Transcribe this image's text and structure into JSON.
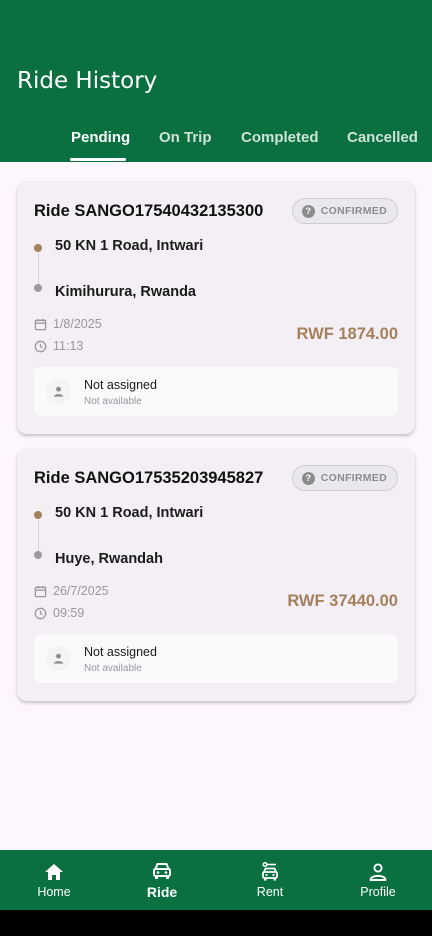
{
  "header": {
    "title": "Ride History",
    "tabs": [
      {
        "label": "Pending",
        "active": true
      },
      {
        "label": "On Trip",
        "active": false
      },
      {
        "label": "Completed",
        "active": false
      },
      {
        "label": "Cancelled",
        "active": false
      }
    ]
  },
  "rides": [
    {
      "title": "Ride SANGO17540432135300",
      "status": "CONFIRMED",
      "pickup": "50 KN 1 Road, Intwari",
      "dropoff": "Kimihurura, Rwanda",
      "date": "1/8/2025",
      "time": "11:13",
      "price": "RWF 1874.00",
      "driver_name": "Not assigned",
      "driver_info": "Not available"
    },
    {
      "title": "Ride SANGO17535203945827",
      "status": "CONFIRMED",
      "pickup": "50 KN 1 Road, Intwari",
      "dropoff": "Huye, Rwandah",
      "date": "26/7/2025",
      "time": "09:59",
      "price": "RWF 37440.00",
      "driver_name": "Not assigned",
      "driver_info": "Not available"
    }
  ],
  "nav": [
    {
      "label": "Home",
      "icon": "home-icon",
      "active": false
    },
    {
      "label": "Ride",
      "icon": "car-icon",
      "active": true
    },
    {
      "label": "Rent",
      "icon": "rent-car-icon",
      "active": false
    },
    {
      "label": "Profile",
      "icon": "person-icon",
      "active": false
    }
  ],
  "colors": {
    "primary": "#0a7040",
    "accent": "#a5805c",
    "background": "#fdf6fc",
    "card": "#f3eff5"
  }
}
